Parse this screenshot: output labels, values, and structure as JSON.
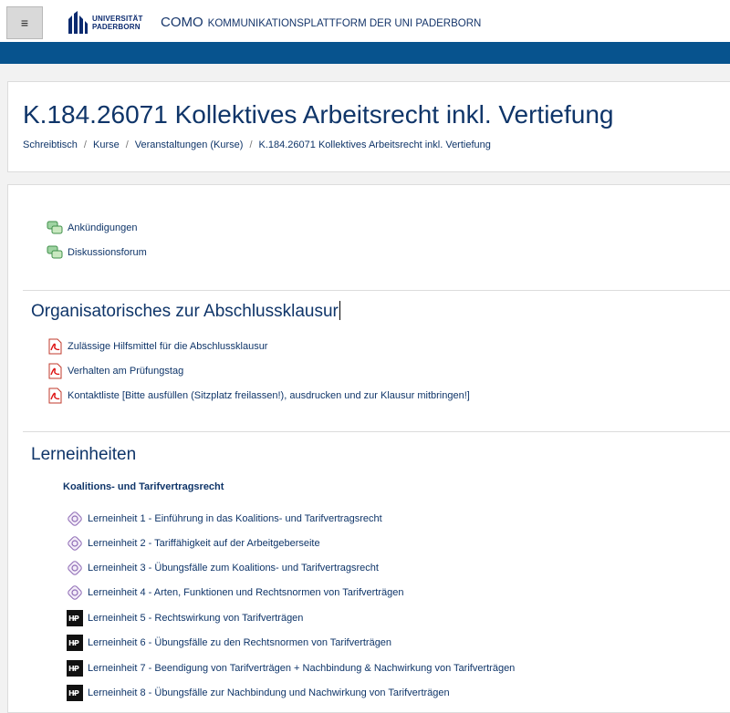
{
  "topbar": {
    "menu_icon": "hamburger-icon",
    "logo_line1": "UNIVERSITÄT",
    "logo_line2": "PADERBORN",
    "site_short": "COMO",
    "site_long": "KOMMUNIKATIONSPLATTFORM DER UNI PADERBORN"
  },
  "colors": {
    "accent": "#07538e",
    "title": "#0f3569"
  },
  "header": {
    "title": "K.184.26071 Kollektives Arbeitsrecht inkl. Vertiefung",
    "breadcrumb": [
      "Schreibtisch",
      "Kurse",
      "Veranstaltungen (Kurse)",
      "K.184.26071 Kollektives Arbeitsrecht inkl. Vertiefung"
    ]
  },
  "general": {
    "items": [
      {
        "label": "Ankündigungen",
        "icon": "forum-icon"
      },
      {
        "label": "Diskussionsforum",
        "icon": "forum-icon"
      }
    ]
  },
  "section1": {
    "title": "Organisatorisches zur Abschlussklausur",
    "items": [
      {
        "label": "Zulässige Hilfsmittel für die Abschlussklausur",
        "icon": "pdf-icon"
      },
      {
        "label": "Verhalten am Prüfungstag",
        "icon": "pdf-icon"
      },
      {
        "label": "Kontaktliste [Bitte ausfüllen (Sitzplatz freilassen!), ausdrucken und zur Klausur mitbringen!]",
        "icon": "pdf-icon"
      }
    ]
  },
  "section2": {
    "title": "Lerneinheiten",
    "subheading": "Koalitions- und Tarifvertragsrecht",
    "items": [
      {
        "label": "Lerneinheit 1 - Einführung in das Koalitions- und Tarifvertragsrecht",
        "icon": "lesson-icon"
      },
      {
        "label": "Lerneinheit 2 - Tariffähigkeit auf der Arbeitgeberseite",
        "icon": "lesson-icon"
      },
      {
        "label": "Lerneinheit 3 - Übungsfälle zum Koalitions- und Tarifvertragsrecht",
        "icon": "lesson-icon"
      },
      {
        "label": "Lerneinheit 4 - Arten, Funktionen und Rechtsnormen von Tarifverträgen",
        "icon": "lesson-icon"
      },
      {
        "label": "Lerneinheit 5 - Rechtswirkung von Tarifverträgen",
        "icon": "h5p-icon"
      },
      {
        "label": "Lerneinheit 6 - Übungsfälle zu den Rechtsnormen von Tarifverträgen",
        "icon": "h5p-icon"
      },
      {
        "label": "Lerneinheit 7 - Beendigung von Tarifverträgen + Nachbindung & Nachwirkung von Tarifverträgen",
        "icon": "h5p-icon"
      },
      {
        "label": "Lerneinheit 8 - Übungsfälle zur Nachbindung und Nachwirkung von Tarifverträgen",
        "icon": "h5p-icon"
      }
    ]
  }
}
